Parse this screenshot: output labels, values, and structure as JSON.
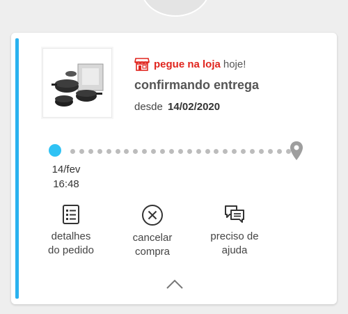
{
  "order": {
    "pickup_label": "pegue na loja",
    "pickup_when": "hoje!",
    "status": "confirmando entrega",
    "since_prefix": "desde",
    "since_date": "14/02/2020"
  },
  "timeline": {
    "date": "14/fev",
    "time": "16:48",
    "start_color": "#2fc2f4",
    "end_icon": "location-pin-icon"
  },
  "actions": {
    "details": {
      "line1": "detalhes",
      "line2": "do pedido",
      "icon": "receipt-list-icon"
    },
    "cancel": {
      "line1": "cancelar",
      "line2": "compra",
      "icon": "circle-x-icon"
    },
    "help": {
      "line1": "preciso de",
      "line2": "ajuda",
      "icon": "chat-bubbles-icon"
    }
  },
  "colors": {
    "accent": "#2ab2ef",
    "pickup_red": "#e0251e"
  }
}
